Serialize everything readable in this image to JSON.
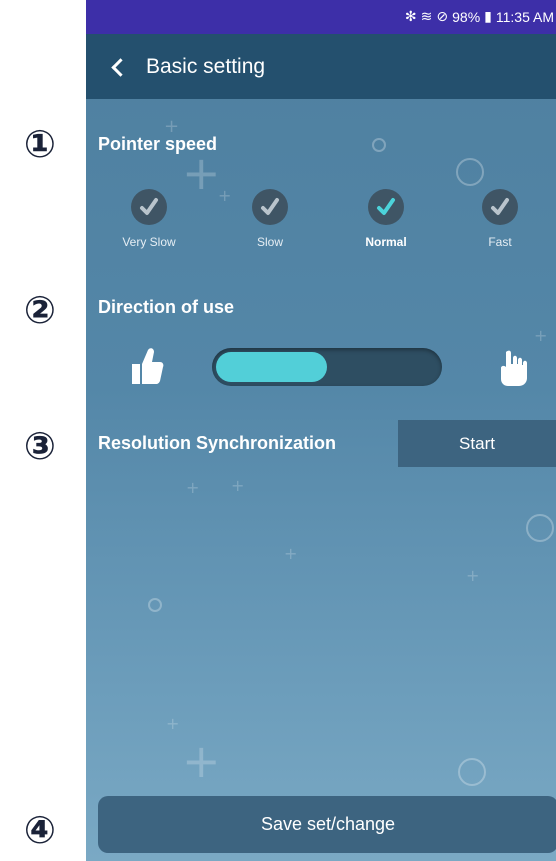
{
  "callouts": [
    "①",
    "②",
    "③",
    "④"
  ],
  "status_bar": {
    "icons": [
      "bluetooth-icon",
      "wifi-icon",
      "do-not-disturb-icon",
      "battery-icon"
    ],
    "battery": "98%",
    "time": "11:35 AM"
  },
  "app_bar": {
    "title": "Basic setting"
  },
  "pointer_speed": {
    "label": "Pointer speed",
    "options": [
      {
        "label": "Very Slow",
        "selected": false
      },
      {
        "label": "Slow",
        "selected": false
      },
      {
        "label": "Normal",
        "selected": true
      },
      {
        "label": "Fast",
        "selected": false
      }
    ]
  },
  "direction": {
    "label": "Direction of use",
    "left_icon": "thumbs-up-hand-icon",
    "right_icon": "pointing-hand-icon",
    "slider_value": 0.5
  },
  "resolution": {
    "label": "Resolution Synchronization",
    "button_label": "Start"
  },
  "save": {
    "label": "Save set/change"
  },
  "colors": {
    "accent": "#4cd3da",
    "app_bar": "#24506e",
    "status_bar": "#3d2fa8",
    "button": "#3d6480"
  }
}
